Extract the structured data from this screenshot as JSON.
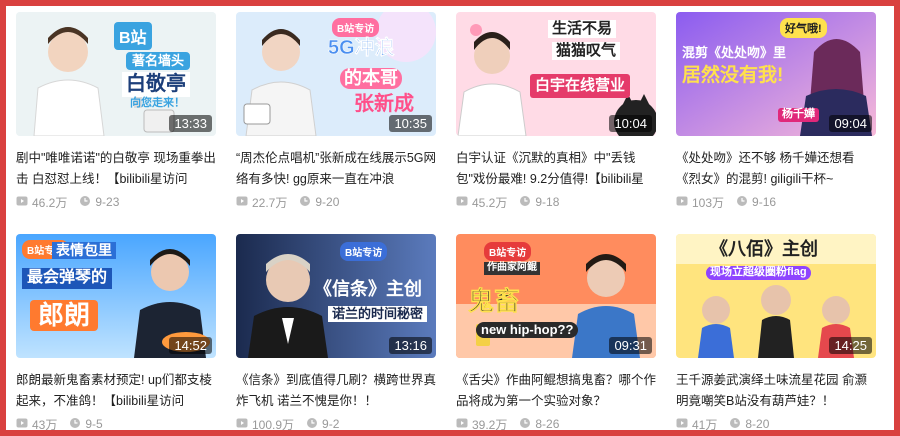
{
  "cards": [
    {
      "duration": "13:33",
      "title": "剧中\"唯唯诺诺\"的白敬亭 现场重拳出击 白怼怼上线！【bilibili星访问",
      "views": "46.2万",
      "date": "9-23",
      "thumb": {
        "bg1": "#cfe6f5",
        "bg2": "#f5f5f0",
        "accent": "#3aa3e0",
        "badge": "B站",
        "line1": "著名墙头",
        "line2": "白敬亭",
        "line3": "向您走来！"
      }
    },
    {
      "duration": "10:35",
      "title": "“周杰伦点唱机”张新成在线展示5G网络有多快! gg原来一直在冲浪",
      "views": "22.7万",
      "date": "9-20",
      "thumb": {
        "bg1": "#d7ecfb",
        "bg2": "#f3e8fb",
        "accent": "#ff6fa0",
        "badge": "B站专访",
        "line1": "5G冲浪",
        "line2": "的本哥",
        "line3": "张新成"
      }
    },
    {
      "duration": "10:04",
      "title": "白宇认证《沉默的真相》中\"丢钱包\"戏份最难! 9.2分值得!【bilibili星",
      "views": "45.2万",
      "date": "9-18",
      "thumb": {
        "bg1": "#ffd6e3",
        "bg2": "#ffeaf0",
        "accent": "#e53b6a",
        "badge": "",
        "line1": "生活不易",
        "line2": "猫猫叹气",
        "line3": "白宇在线营业"
      }
    },
    {
      "duration": "09:04",
      "title": "《处处吻》还不够 杨千嬅还想看《烈女》的混剪! giligili干杯~",
      "views": "103万",
      "date": "9-16",
      "thumb": {
        "bg1": "#9b6cf0",
        "bg2": "#f6c1dc",
        "accent": "#ffe14d",
        "badge": "好气哦!",
        "line1": "混剪《处处吻》里",
        "line2": "居然没有我!",
        "line3": "杨千嬅"
      }
    },
    {
      "duration": "14:52",
      "title": "郎朗最新鬼畜素材预定! up们都支棱起来，不准鸽！【bilibili星访问",
      "views": "43万",
      "date": "9-5",
      "thumb": {
        "bg1": "#5fb6ff",
        "bg2": "#bfe3ff",
        "accent": "#ff7a2f",
        "badge": "B站专访",
        "line1": "表情包里",
        "line2": "最会弹琴的",
        "line3": "郎朗"
      }
    },
    {
      "duration": "13:16",
      "title": "《信条》到底值得几刷？横跨世界真炸飞机 诺兰不愧是你！！",
      "views": "100.9万",
      "date": "9-2",
      "thumb": {
        "bg1": "#2b3d6b",
        "bg2": "#5b7bbd",
        "accent": "#ffffff",
        "badge": "B站专访",
        "line1": "《信条》主创",
        "line2": "诺兰的时间秘密",
        "line3": ""
      }
    },
    {
      "duration": "09:31",
      "title": "《舌尖》作曲阿鲲想搞鬼畜？哪个作品将成为第一个实验对象？",
      "views": "39.2万",
      "date": "8-26",
      "thumb": {
        "bg1": "#ff8a5c",
        "bg2": "#ffd0b8",
        "accent": "#ffe14d",
        "badge": "B站专访",
        "line1": "鬼畜",
        "line2": "new hip-hop??",
        "line3": "作曲家阿鲲"
      }
    },
    {
      "duration": "14:25",
      "title": "王千源姜武演绎土味流星花园 俞灏明竟嘲笑B站没有葫芦娃？！",
      "views": "41万",
      "date": "8-20",
      "thumb": {
        "bg1": "#ffe27a",
        "bg2": "#fff4c4",
        "accent": "#8e44ff",
        "badge": "",
        "line1": "《八佰》主创",
        "line2": "现场立超级圈粉flag",
        "line3": ""
      }
    }
  ]
}
